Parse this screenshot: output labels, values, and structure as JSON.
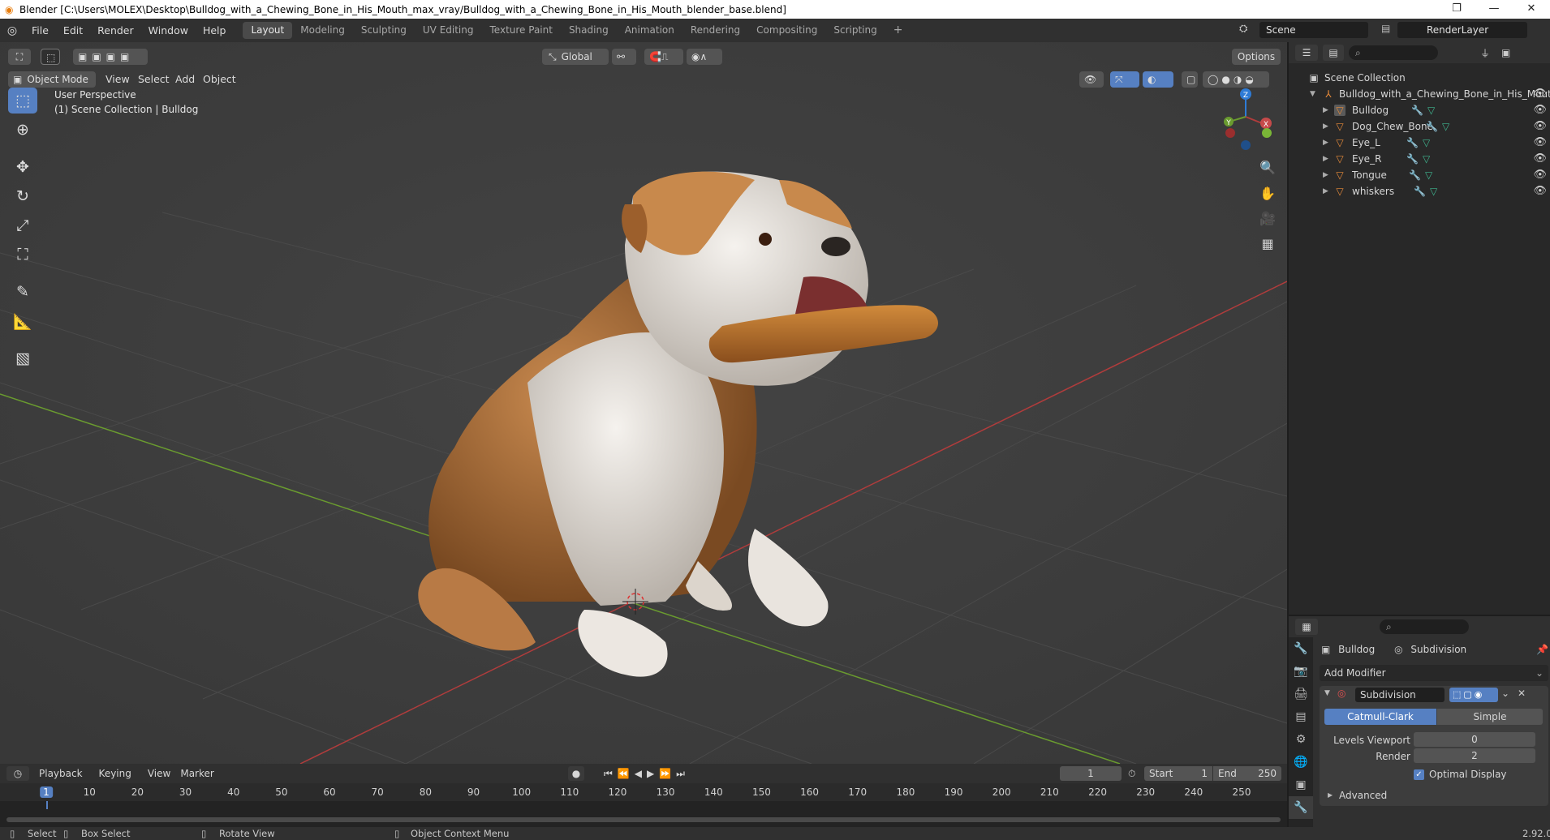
{
  "window": {
    "title": "Blender [C:\\Users\\MOLEX\\Desktop\\Bulldog_with_a_Chewing_Bone_in_His_Mouth_max_vray/Bulldog_with_a_Chewing_Bone_in_His_Mouth_blender_base.blend]",
    "controls": [
      "—",
      "❐",
      "✕"
    ]
  },
  "menubar": {
    "menus": [
      "File",
      "Edit",
      "Render",
      "Window",
      "Help"
    ],
    "workspaces": [
      "Layout",
      "Modeling",
      "Sculpting",
      "UV Editing",
      "Texture Paint",
      "Shading",
      "Animation",
      "Rendering",
      "Compositing",
      "Scripting"
    ],
    "active_workspace": "Layout",
    "add_tab": "+",
    "scene": "Scene",
    "view_layer": "RenderLayer"
  },
  "viewport": {
    "mode": "Object Mode",
    "menus": [
      "View",
      "Select",
      "Add",
      "Object"
    ],
    "transform_orientation": "Global",
    "options": "Options",
    "overlay_line1": "User Perspective",
    "overlay_line2": "(1) Scene Collection | Bulldog",
    "gizmo": {
      "x": "X",
      "y": "Y",
      "z": "Z"
    }
  },
  "toolbar": {
    "tools": [
      "select-box",
      "cursor",
      "move",
      "rotate",
      "scale",
      "transform",
      "annotate",
      "measure",
      "add-cube"
    ],
    "active_tool": "select-box"
  },
  "outliner": {
    "root": "Scene Collection",
    "collection": "Bulldog_with_a_Chewing_Bone_in_His_Mout",
    "objects": [
      "Bulldog",
      "Dog_Chew_Bone",
      "Eye_L",
      "Eye_R",
      "Tongue",
      "whiskers"
    ],
    "active_object": "Bulldog"
  },
  "properties": {
    "object_name": "Bulldog",
    "modifier_name": "Subdivision",
    "add_modifier": "Add Modifier",
    "modifier_field": "Subdivision",
    "algorithms": [
      "Catmull-Clark",
      "Simple"
    ],
    "active_algorithm": "Catmull-Clark",
    "levels_viewport_label": "Levels Viewport",
    "levels_viewport": "0",
    "render_label": "Render",
    "render_levels": "2",
    "optimal_display_label": "Optimal Display",
    "optimal_display": true,
    "advanced": "Advanced"
  },
  "timeline": {
    "menus": [
      "Playback",
      "Keying",
      "View",
      "Marker"
    ],
    "current_frame": "1",
    "start_label": "Start",
    "start": "1",
    "end_label": "End",
    "end": "250",
    "ruler": [
      "1",
      "10",
      "20",
      "30",
      "40",
      "50",
      "60",
      "70",
      "80",
      "90",
      "100",
      "110",
      "120",
      "130",
      "140",
      "150",
      "160",
      "170",
      "180",
      "190",
      "200",
      "210",
      "220",
      "230",
      "240",
      "250"
    ]
  },
  "statusbar": {
    "select": "Select",
    "box_select": "Box Select",
    "rotate_view": "Rotate View",
    "context_menu": "Object Context Menu",
    "version": "2.92.0"
  },
  "colors": {
    "accent": "#5680c2",
    "bg": "#3d3d3d",
    "panel": "#303030",
    "x_axis": "#b03c3c",
    "y_axis": "#6a9b2f",
    "z_axis": "#2e7bd6",
    "object_orange": "#e88b3a"
  }
}
